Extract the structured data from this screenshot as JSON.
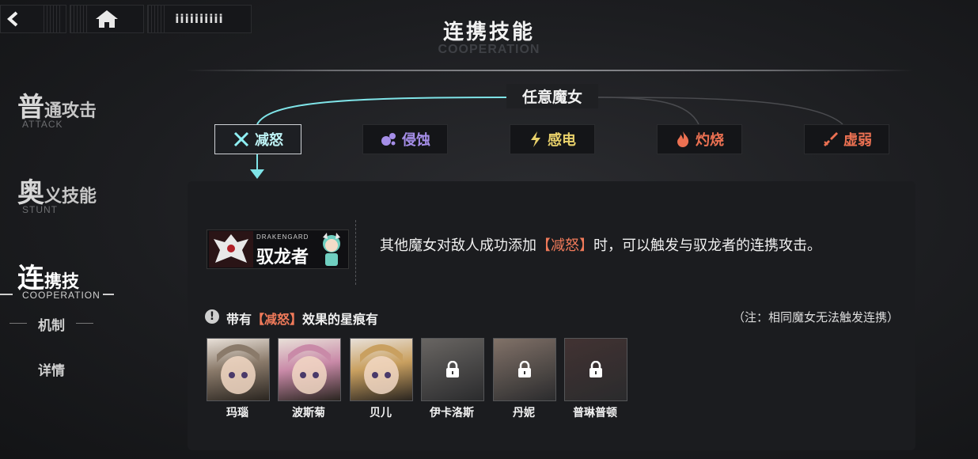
{
  "nav": {
    "menu_label": "iiiiiiiiii"
  },
  "header": {
    "title": "连携技能",
    "subtitle": "COOPERATION"
  },
  "sidebar": {
    "items": [
      {
        "big": "普",
        "rest": "通攻击",
        "en": "ATTACK"
      },
      {
        "big": "奥",
        "rest": "义技能",
        "en": "STUNT"
      },
      {
        "big": "连",
        "rest": "携技",
        "en": "COOPERATION"
      }
    ],
    "sub_items": [
      "机制",
      "详情"
    ]
  },
  "any_witch_label": "任意魔女",
  "effect_tags": [
    {
      "label": "减怒",
      "color": "#bff4f6",
      "icon": "cross-burst-icon",
      "selected": true
    },
    {
      "label": "侵蚀",
      "color": "#a58ee8",
      "icon": "bubbles-icon",
      "selected": false
    },
    {
      "label": "感电",
      "color": "#e8d06a",
      "icon": "lightning-icon",
      "selected": false
    },
    {
      "label": "灼烧",
      "color": "#ec7152",
      "icon": "flame-icon",
      "selected": false
    },
    {
      "label": "虚弱",
      "color": "#ec7152",
      "icon": "broken-sword-icon",
      "selected": false
    }
  ],
  "character_badge": {
    "en": "DRAKENGARD",
    "name": "驭龙者"
  },
  "description": {
    "before": "其他魔女对敌人成功添加",
    "highlight": "【减怒】",
    "after": "时，可以触发与驭龙者的连携攻击。"
  },
  "owners": {
    "title_before": "带有",
    "title_highlight": "【减怒】",
    "title_after": "效果的星痕有",
    "note": "（注：相同魔女无法触发连携）",
    "characters": [
      {
        "name": "玛瑙",
        "locked": false,
        "bg": "#8a7a6a"
      },
      {
        "name": "波斯菊",
        "locked": false,
        "bg": "#c98aa8"
      },
      {
        "name": "贝儿",
        "locked": false,
        "bg": "#c9a060"
      },
      {
        "name": "伊卡洛斯",
        "locked": true,
        "bg": "#6a6560"
      },
      {
        "name": "丹妮",
        "locked": true,
        "bg": "#8a7060"
      },
      {
        "name": "普琳普顿",
        "locked": true,
        "bg": "#4a3030"
      }
    ]
  }
}
